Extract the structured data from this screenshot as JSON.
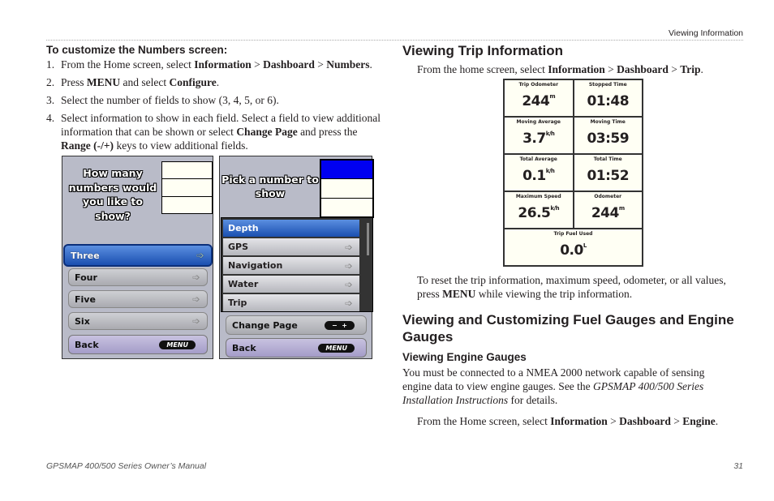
{
  "header": {
    "section": "Viewing Information"
  },
  "left": {
    "heading": "To customize the Numbers screen:",
    "steps": [
      {
        "n": "1.",
        "text": "From the Home screen, select ",
        "b1": "Information",
        " s1": "",
        "sep1": " > ",
        "b2": "Dashboard",
        "sep2": " > ",
        "b3": "Numbers",
        "end": "."
      },
      {
        "n": "2.",
        "pre": "Press ",
        "b1": "MENU",
        "mid": " and select ",
        "b2": "Configure",
        "end": "."
      },
      {
        "n": "3.",
        "text": "Select the number of fields to show (3, 4, 5, or 6)."
      },
      {
        "n": "4.",
        "pre": "Select information to show in each field. Select a field to view additional information that can be shown or select ",
        "b1": "Change Page",
        "mid": " and press the ",
        "b2": "Range (-/+)",
        "end": " keys to view additional fields."
      }
    ],
    "screen1": {
      "prompt": "How many numbers would you like to show?",
      "options": [
        "Three",
        "Four",
        "Five",
        "Six"
      ],
      "back": "Back",
      "menu": "MENU"
    },
    "screen2": {
      "prompt": "Pick a number to show",
      "items": [
        "Depth",
        "GPS",
        "Navigation",
        "Water",
        "Trip"
      ],
      "change_page": "Change Page",
      "minus": "−",
      "plus": "+",
      "back": "Back",
      "menu": "MENU"
    }
  },
  "right": {
    "h_trip": "Viewing Trip Information",
    "trip_para": {
      "pre": "From the home screen, select ",
      "b1": "Information",
      "sep1": " > ",
      "b2": "Dashboard",
      "sep2": " > ",
      "b3": "Trip",
      "end": "."
    },
    "trip_fields": [
      {
        "label": "Trip Odometer",
        "value": "244",
        "unit": "m"
      },
      {
        "label": "Stopped Time",
        "value": "01:48",
        "unit": ""
      },
      {
        "label": "Moving Average",
        "value": "3.7",
        "unit": "k/h"
      },
      {
        "label": "Moving Time",
        "value": "03:59",
        "unit": ""
      },
      {
        "label": "Total Average",
        "value": "0.1",
        "unit": "k/h"
      },
      {
        "label": "Total Time",
        "value": "01:52",
        "unit": ""
      },
      {
        "label": "Maximum Speed",
        "value": "26.5",
        "unit": "k/h"
      },
      {
        "label": "Odometer",
        "value": "244",
        "unit": "m"
      },
      {
        "label": "Trip Fuel Used",
        "value": "0.0",
        "unit": "L"
      }
    ],
    "reset_para": {
      "pre": "To reset the trip information, maximum speed, odometer, or all values, press ",
      "b1": "MENU",
      "end": " while viewing the trip information."
    },
    "h_fuel": "Viewing and Customizing Fuel Gauges and Engine Gauges",
    "h_engine": "Viewing Engine Gauges",
    "engine_para": {
      "pre": "You must be connected to a NMEA 2000 network capable of sensing engine data to view engine gauges. See the ",
      "i1": "GPSMAP 400/500 Series Installation Instructions",
      "end": " for details."
    },
    "engine_para2": {
      "pre": "From the Home screen, select ",
      "b1": "Information",
      "sep1": " > ",
      "b2": "Dashboard",
      "sep2": " > ",
      "b3": "Engine",
      "end": "."
    }
  },
  "footer": {
    "title": "GPSMAP 400/500 Series Owner’s Manual",
    "page": "31"
  }
}
